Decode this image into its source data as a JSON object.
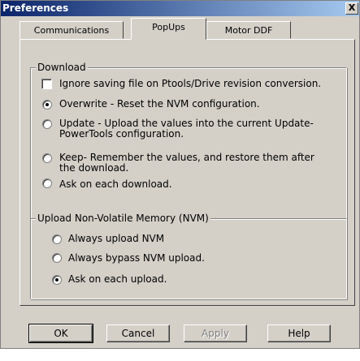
{
  "window": {
    "title": "Preferences",
    "close_label": "X"
  },
  "tabs": [
    {
      "label": "Communications",
      "active": false
    },
    {
      "label": "PopUps",
      "active": true
    },
    {
      "label": "Motor DDF",
      "active": false
    }
  ],
  "download_group": {
    "legend": "Download",
    "ignore_checkbox": {
      "label": "Ignore saving file on Ptools/Drive revision conversion.",
      "checked": false
    },
    "options": [
      {
        "label_line1": "Overwrite - Reset the NVM configuration.",
        "label_line2": "",
        "selected": true
      },
      {
        "label_line1": "Update - Upload the values into the current Update-",
        "label_line2": "PowerTools configuration.",
        "selected": false
      },
      {
        "label_line1": "Keep- Remember the values, and restore them after",
        "label_line2": "the download.",
        "selected": false
      },
      {
        "label_line1": "Ask on each download.",
        "label_line2": "",
        "selected": false
      }
    ]
  },
  "upload_group": {
    "legend": "Upload Non-Volatile Memory (NVM)",
    "options": [
      {
        "label": "Always upload NVM",
        "selected": false
      },
      {
        "label": "Always bypass NVM upload.",
        "selected": false
      },
      {
        "label": "Ask on each upload.",
        "selected": true
      }
    ]
  },
  "buttons": {
    "ok": "OK",
    "cancel": "Cancel",
    "apply": "Apply",
    "help": "Help"
  }
}
